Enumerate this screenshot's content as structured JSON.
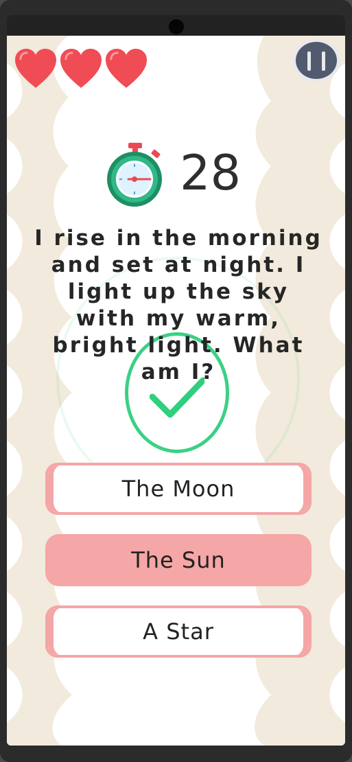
{
  "game": {
    "lives": 3,
    "timer_value": "28",
    "question": "I rise in the morning and set at night. I light up the sky with my warm, bright light. What am I?",
    "answers": [
      {
        "label": "The Moon",
        "selected": false
      },
      {
        "label": "The Sun",
        "selected": true
      },
      {
        "label": "A Star",
        "selected": false
      }
    ]
  },
  "colors": {
    "heart": "#ef4c55",
    "answer_accent": "#f4a6a6",
    "correct": "#2fcf7d",
    "background_shape": "#f2eadc",
    "pause_button": "#525a6e"
  },
  "icons": [
    "heart-icon",
    "pause-icon",
    "stopwatch-icon",
    "checkmark-icon"
  ]
}
